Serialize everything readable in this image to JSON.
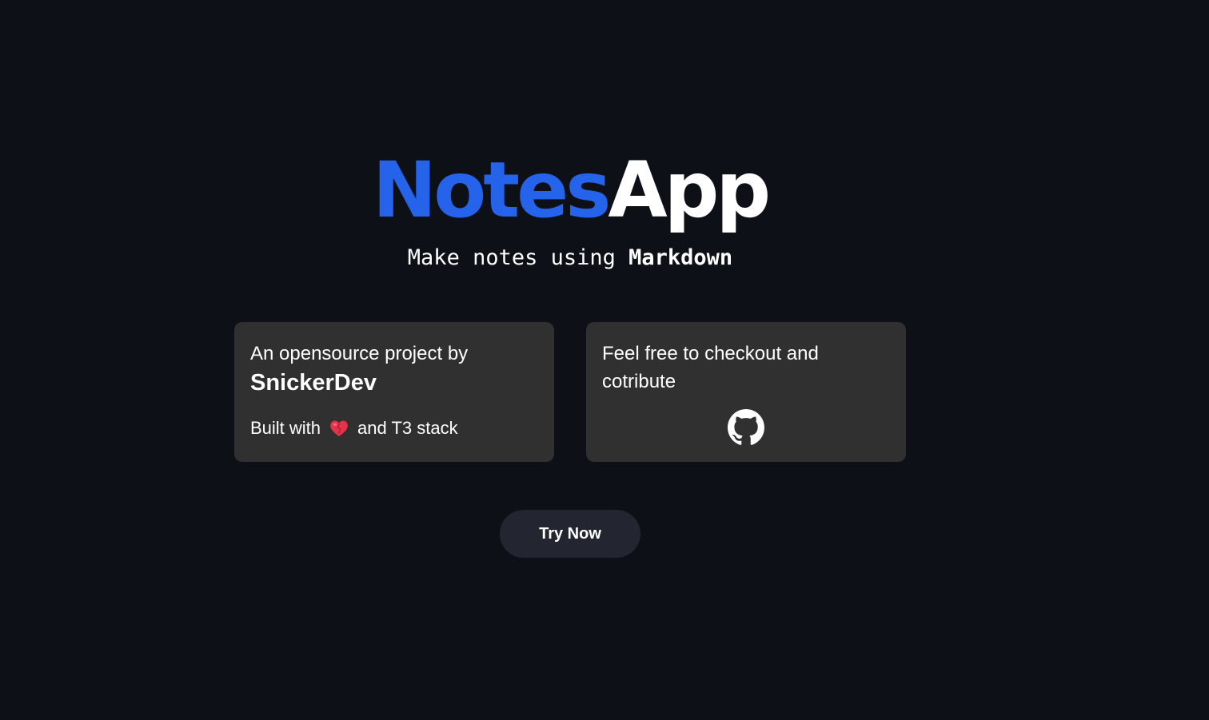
{
  "hero": {
    "title_part_a": "Notes",
    "title_part_b": "App",
    "accent_color": "#2563eb"
  },
  "tagline": {
    "prefix": "Make notes using ",
    "emphasis": "Markdown"
  },
  "card_left": {
    "intro": "An opensource project by",
    "author": "SnickerDev",
    "built_prefix": "Built with",
    "built_icon": "heart-icon",
    "built_suffix": "and T3 stack"
  },
  "card_right": {
    "text": "Feel free to checkout and cotribute",
    "icon": "github-icon"
  },
  "cta": {
    "label": "Try Now"
  },
  "colors": {
    "background": "#0d1017",
    "card": "#303030",
    "button": "#232630"
  }
}
